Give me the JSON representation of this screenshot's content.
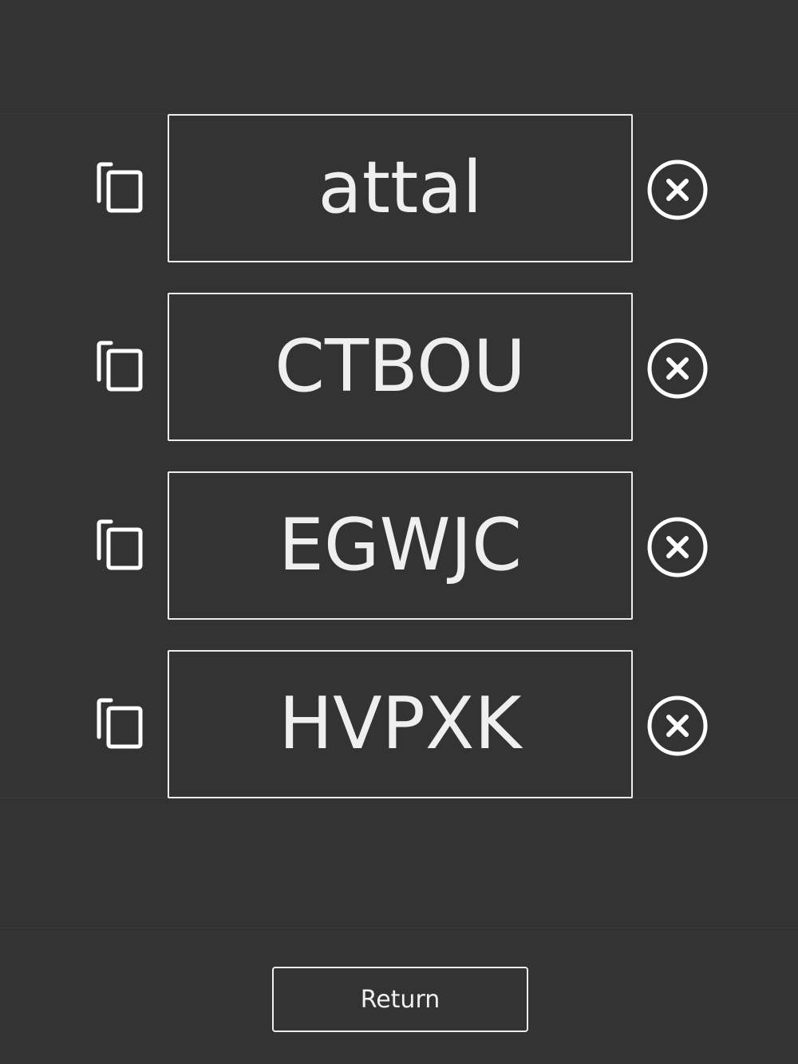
{
  "codes": [
    {
      "text": "attal",
      "copy_icon": "copy-icon",
      "remove_icon": "close-circle-icon"
    },
    {
      "text": "CTBOU",
      "copy_icon": "copy-icon",
      "remove_icon": "close-circle-icon"
    },
    {
      "text": "EGWJC",
      "copy_icon": "copy-icon",
      "remove_icon": "close-circle-icon"
    },
    {
      "text": "HVPXK",
      "copy_icon": "copy-icon",
      "remove_icon": "close-circle-icon"
    }
  ],
  "footer": {
    "return_label": "Return"
  },
  "colors": {
    "background": "#333333",
    "foreground": "#efefef",
    "divider": "#3b3b3b"
  }
}
